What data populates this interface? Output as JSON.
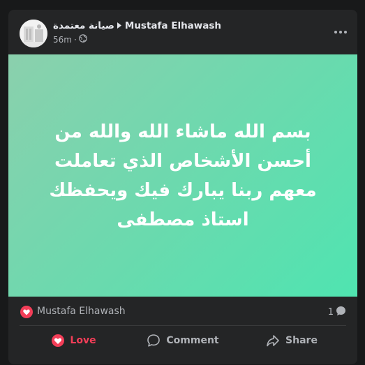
{
  "post": {
    "page_name": "صيانة معتمدة",
    "author_name": "Mustafa Elhawash",
    "time": "56m",
    "audience_icon": "globe-icon",
    "more_icon": "more-options-icon"
  },
  "banner": {
    "text": "بسم الله ماشاء الله والله من أحسن الأشخاص الذي تعاملت معهم ربنا يبارك فيك ويحفظك استاذ مصطفى",
    "background_start": "#8bd0ad",
    "background_end": "#4fe4b0",
    "text_color": "#ffffff"
  },
  "reactions": {
    "reactor": "Mustafa Elhawash",
    "comment_count": "1",
    "reaction_icon": "heart-icon",
    "reaction_color": "#f33e58"
  },
  "actions": {
    "love_label": "Love",
    "comment_label": "Comment",
    "share_label": "Share"
  }
}
